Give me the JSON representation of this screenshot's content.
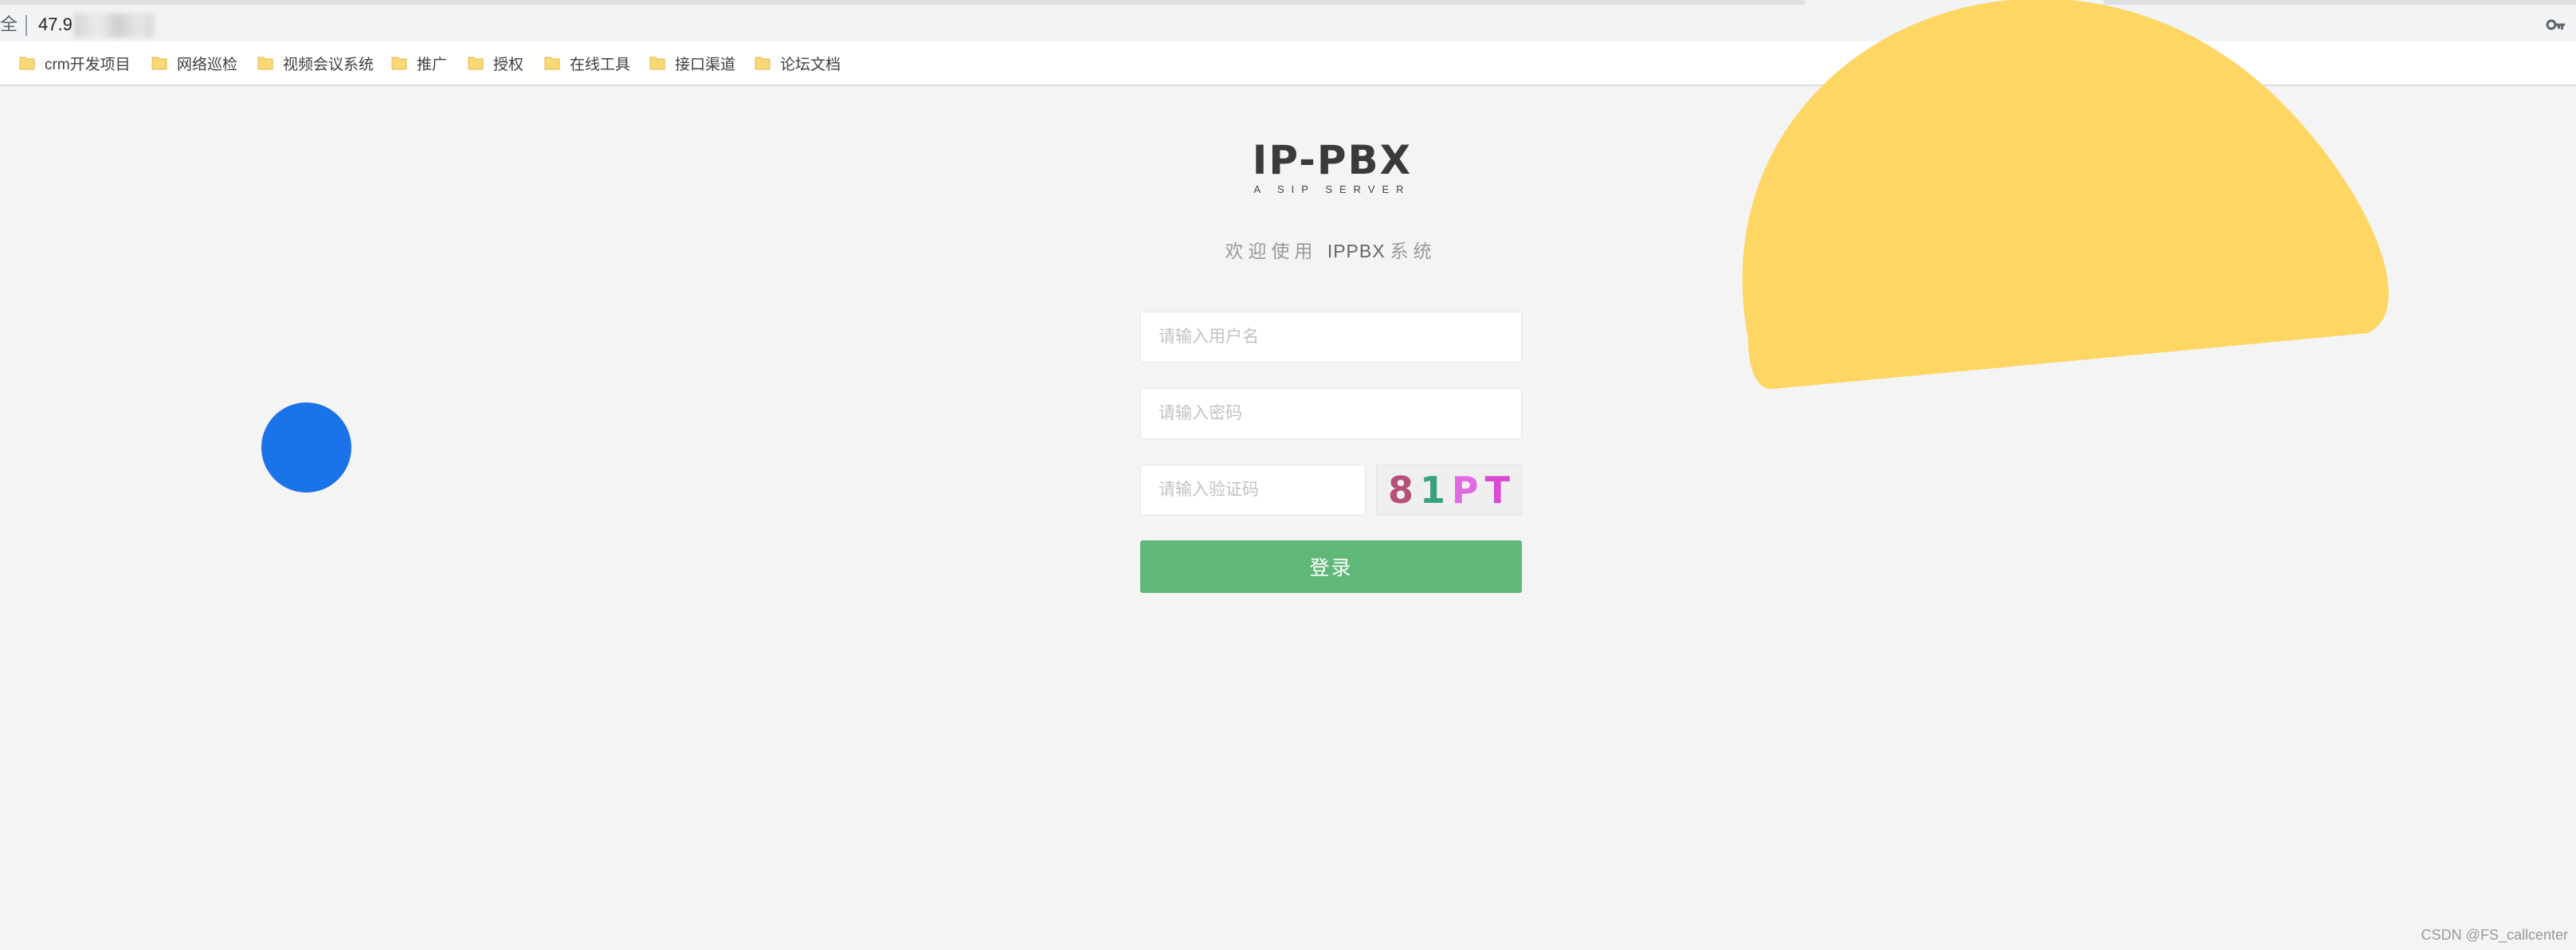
{
  "browser": {
    "security_label": "全",
    "url_prefix": "47.9",
    "bookmarks": [
      {
        "label": "crm开发项目"
      },
      {
        "label": "网络巡检"
      },
      {
        "label": "视频会议系统"
      },
      {
        "label": "推广"
      },
      {
        "label": "授权"
      },
      {
        "label": "在线工具"
      },
      {
        "label": "接口渠道"
      },
      {
        "label": "论坛文档"
      }
    ]
  },
  "logo": {
    "title": "IP-PBX",
    "subtitle": "A SIP SERVER"
  },
  "welcome": {
    "before": "欢迎使用",
    "brand": "IPPBX",
    "after": "系统"
  },
  "form": {
    "username_placeholder": "请输入用户名",
    "password_placeholder": "请输入密码",
    "captcha_placeholder": "请输入验证码",
    "captcha_chars": [
      "8",
      "1",
      "P",
      "T"
    ],
    "captcha_colors": [
      "#b5507a",
      "#3aa17e",
      "#e06adf",
      "#d94bd4"
    ],
    "login_label": "登录"
  },
  "colors": {
    "accent_green": "#5fb878",
    "decor_yellow": "#fdd663",
    "decor_blue": "#1a73e8"
  },
  "watermark": "CSDN @FS_callcenter"
}
